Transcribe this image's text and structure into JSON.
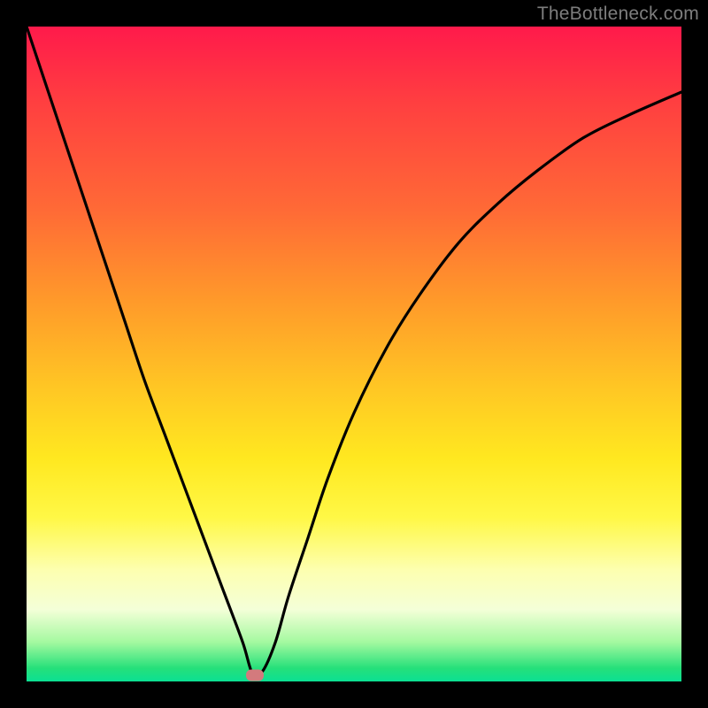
{
  "watermark": "TheBottleneck.com",
  "colors": {
    "frame": "#000000",
    "curve": "#000000",
    "marker": "#d37a7d",
    "watermark": "#7d7d7d"
  },
  "chart_data": {
    "type": "line",
    "title": "",
    "xlabel": "",
    "ylabel": "",
    "xlim": [
      0,
      100
    ],
    "ylim": [
      0,
      100
    ],
    "grid": false,
    "curve": {
      "x": [
        0,
        3,
        6,
        9,
        12,
        15,
        18,
        21,
        24,
        27,
        30,
        33,
        34.5,
        36,
        38,
        40,
        43,
        46,
        50,
        55,
        60,
        66,
        72,
        78,
        85,
        92,
        100
      ],
      "y": [
        100,
        91,
        82,
        73,
        64,
        55,
        46,
        38,
        30,
        22,
        14,
        6,
        1.2,
        1.5,
        6,
        13,
        22,
        31,
        41,
        51,
        59,
        67,
        73,
        78,
        83,
        86.5,
        90
      ]
    },
    "marker": {
      "x": 34.8,
      "y": 0.9
    },
    "background_gradient_stops": [
      {
        "pos": 0,
        "color": "#ff1a4b"
      },
      {
        "pos": 12,
        "color": "#ff4040"
      },
      {
        "pos": 28,
        "color": "#ff6a36"
      },
      {
        "pos": 42,
        "color": "#ff9a2a"
      },
      {
        "pos": 55,
        "color": "#ffc624"
      },
      {
        "pos": 66,
        "color": "#ffe820"
      },
      {
        "pos": 75,
        "color": "#fff846"
      },
      {
        "pos": 83,
        "color": "#fdffb0"
      },
      {
        "pos": 89,
        "color": "#f4ffd8"
      },
      {
        "pos": 94,
        "color": "#a4f9a0"
      },
      {
        "pos": 98,
        "color": "#25e07a"
      },
      {
        "pos": 100,
        "color": "#0be093"
      }
    ]
  }
}
